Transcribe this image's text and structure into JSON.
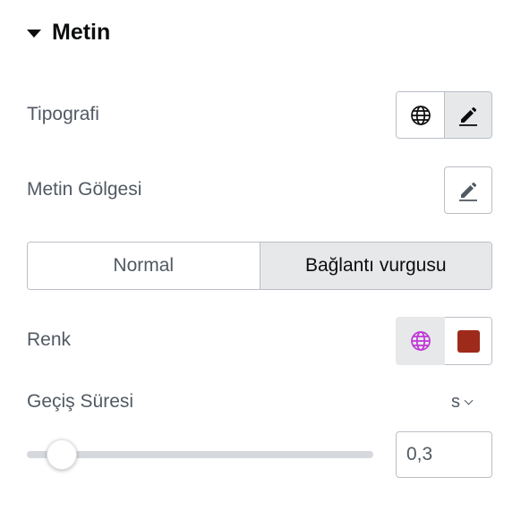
{
  "section": {
    "title": "Metin",
    "expanded": true
  },
  "typography": {
    "label": "Tipografi",
    "buttons": [
      "globe-icon",
      "pencil-icon"
    ],
    "active": "pencil-icon"
  },
  "text_shadow": {
    "label": "Metin Gölgesi",
    "button_icon": "pencil-icon"
  },
  "state_tabs": {
    "items": [
      "Normal",
      "Bağlantı vurgusu"
    ],
    "active": "Bağlantı vurgusu"
  },
  "color": {
    "label": "Renk",
    "global_icon": "globe-icon",
    "global_icon_color": "#c035d6",
    "value": "#9e2a1c"
  },
  "transition": {
    "label": "Geçiş Süresi",
    "unit": "s",
    "value": "0,3",
    "slider_fraction": 0.1
  },
  "accent_colors": {
    "text": "#515962",
    "heading": "#0c0d0e",
    "border": "#babfc5",
    "active_bg": "#e6e8ea"
  }
}
